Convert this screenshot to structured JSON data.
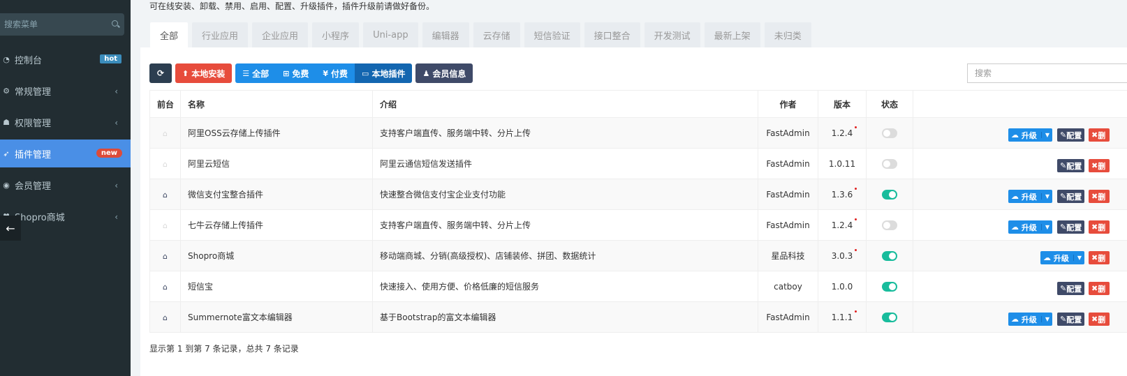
{
  "sidebar": {
    "search_placeholder": "搜索菜单",
    "items": [
      {
        "icon": "dashboard-icon",
        "label": "控制台",
        "badge": "hot"
      },
      {
        "icon": "cogs-icon",
        "label": "常规管理"
      },
      {
        "icon": "users-icon",
        "label": "权限管理"
      },
      {
        "icon": "rocket-icon",
        "label": "插件管理",
        "badge": "new"
      },
      {
        "icon": "user-circle-icon",
        "label": "会员管理"
      },
      {
        "icon": "shop-icon",
        "label": "Shopro商城"
      }
    ]
  },
  "page": {
    "description": "可在线安装、卸载、禁用、启用、配置、升级插件，插件升级前请做好备份。"
  },
  "tabs": [
    "全部",
    "行业应用",
    "企业应用",
    "小程序",
    "Uni-app",
    "编辑器",
    "云存储",
    "短信验证",
    "接口整合",
    "开发测试",
    "最新上架",
    "未归类"
  ],
  "toolbar": {
    "local_install": "本地安装",
    "filter_all": "全部",
    "filter_free": "免费",
    "filter_paid": "付费",
    "filter_local": "本地插件",
    "member_info": "会员信息",
    "search_placeholder": "搜索"
  },
  "table": {
    "headers": {
      "front": "前台",
      "name": "名称",
      "intro": "介绍",
      "author": "作者",
      "version": "版本",
      "status": "状态"
    },
    "actions": {
      "upgrade": "升级",
      "config": "配置",
      "delete": "删"
    },
    "rows": [
      {
        "name": "阿里OSS云存储上传插件",
        "intro": "支持客户端直传、服务端中转、分片上传",
        "author": "FastAdmin",
        "version": "1.2.4"
      },
      {
        "name": "阿里云短信",
        "intro": "阿里云通信短信发送插件",
        "author": "FastAdmin",
        "version": "1.0.11"
      },
      {
        "name": "微信支付宝整合插件",
        "intro": "快速整合微信支付宝企业支付功能",
        "author": "FastAdmin",
        "version": "1.3.6"
      },
      {
        "name": "七牛云存储上传插件",
        "intro": "支持客户端直传、服务端中转、分片上传",
        "author": "FastAdmin",
        "version": "1.2.4"
      },
      {
        "name": "Shopro商城",
        "intro": "移动端商城、分销(高级授权)、店铺装修、拼团、数据统计",
        "author": "星品科技",
        "version": "3.0.3"
      },
      {
        "name": "短信宝",
        "intro": "快速接入、使用方便、价格低廉的短信服务",
        "author": "catboy",
        "version": "1.0.0"
      },
      {
        "name": "Summernote富文本编辑器",
        "intro": "基于Bootstrap的富文本编辑器",
        "author": "FastAdmin",
        "version": "1.1.1"
      }
    ]
  },
  "footer": {
    "summary": "显示第 1 到第 7 条记录，总共 7 条记录"
  }
}
